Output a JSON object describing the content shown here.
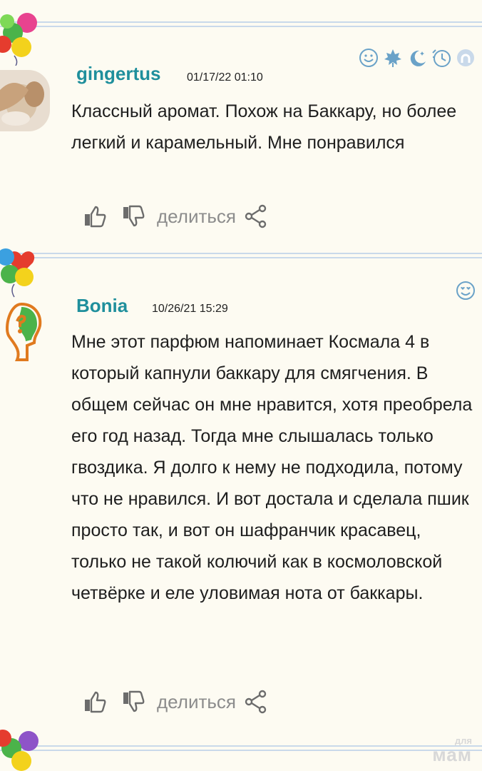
{
  "comments": [
    {
      "username": "gingertus",
      "datetime": "01/17/22 01:10",
      "text": "Классный аромат. Похож на Баккару, но более легкий и карамельный. Мне понравился",
      "share_label": "делиться",
      "badges": [
        "smile-icon",
        "maple-leaf-icon",
        "moon-stars-icon",
        "clock-icon",
        "arch-icon"
      ]
    },
    {
      "username": "Bonia",
      "datetime": "10/26/21 15:29",
      "text": "Мне этот парфюм напоминает Космала 4 в который капнули баккару для смягчения. В общем сейчас он мне нравится, хотя преобрела его год назад. Тогда мне слышалась только гвоздика. Я долго к нему не подходила, потому что не нравился. И вот достала и сделала пшик просто так, и вот он шафранчик красавец, только не такой колючий как в космоловской четвёрке и еле уловимая нота от баккары.",
      "share_label": "делиться",
      "badges": [
        "heart-eyes-icon"
      ]
    }
  ],
  "watermark": {
    "line1": "для",
    "line2": "мам"
  },
  "colors": {
    "username": "#1f8f9c",
    "icon": "#6c6c6c",
    "badge": "#6aa2c8",
    "separator": "#c9d9ea"
  }
}
